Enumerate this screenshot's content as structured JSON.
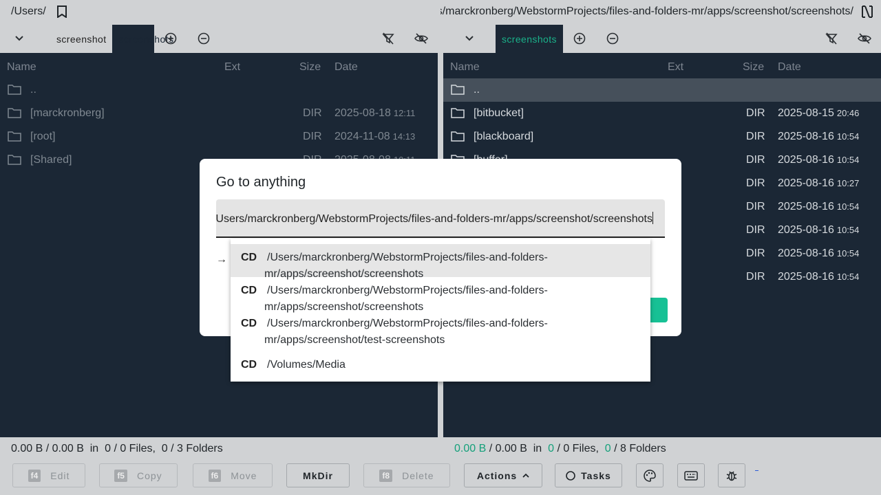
{
  "left": {
    "path": "/Users/",
    "tabs": [
      "screenshot",
      "screenshots"
    ],
    "columns": {
      "name": "Name",
      "ext": "Ext",
      "size": "Size",
      "date": "Date"
    },
    "rows": [
      {
        "name": "..",
        "size": "",
        "date": "",
        "time": ""
      },
      {
        "name": "[marckronberg]",
        "size": "DIR",
        "date": "2025-08-18",
        "time": "12:11"
      },
      {
        "name": "[root]",
        "size": "DIR",
        "date": "2024-11-08",
        "time": "14:13"
      },
      {
        "name": "[Shared]",
        "size": "DIR",
        "date": "2025-08-08",
        "time": "10:11"
      }
    ],
    "status": {
      "a": "0.00 B",
      "b": " / 0.00 B  in  ",
      "c": "0",
      "d": " / 0 Files,  ",
      "e": "0",
      "f": " / 3 Folders"
    }
  },
  "right": {
    "path": "/Users/marckronberg/WebstormProjects/files-and-folders-mr/apps/screenshot/screenshots/",
    "tabs": [
      "screenshots"
    ],
    "columns": {
      "name": "Name",
      "ext": "Ext",
      "size": "Size",
      "date": "Date"
    },
    "rows": [
      {
        "name": "..",
        "size": "",
        "date": "",
        "time": ""
      },
      {
        "name": "[bitbucket]",
        "size": "DIR",
        "date": "2025-08-15",
        "time": "20:46"
      },
      {
        "name": "[blackboard]",
        "size": "DIR",
        "date": "2025-08-16",
        "time": "10:54"
      },
      {
        "name": "[buffer]",
        "size": "DIR",
        "date": "2025-08-16",
        "time": "10:54"
      },
      {
        "name": "",
        "size": "DIR",
        "date": "2025-08-16",
        "time": "10:27"
      },
      {
        "name": "",
        "size": "DIR",
        "date": "2025-08-16",
        "time": "10:54"
      },
      {
        "name": "",
        "size": "DIR",
        "date": "2025-08-16",
        "time": "10:54"
      },
      {
        "name": "",
        "size": "DIR",
        "date": "2025-08-16",
        "time": "10:54"
      },
      {
        "name": "",
        "size": "DIR",
        "date": "2025-08-16",
        "time": "10:54"
      }
    ],
    "status": {
      "a": "0.00 B",
      "b": " / 0.00 B  in  ",
      "c": "0",
      "d": " / 0 Files,  ",
      "e": "0",
      "f": " / 8 Folders"
    }
  },
  "buttons": {
    "edit": {
      "key": "f4",
      "label": "Edit"
    },
    "copy": {
      "key": "f5",
      "label": "Copy"
    },
    "move": {
      "key": "f6",
      "label": "Move"
    },
    "mkdir": {
      "label": "MkDir"
    },
    "delete": {
      "key": "f8",
      "label": "Delete"
    },
    "actions": {
      "label": "Actions"
    },
    "tasks": {
      "label": "Tasks"
    }
  },
  "dialog": {
    "title": "Go to anything",
    "input_value": "/Users/marckronberg/WebstormProjects/files-and-folders-mr/apps/screenshot/screenshots",
    "arrow": "→",
    "suggestions": [
      {
        "prefix": "CD",
        "line1": "/Users/marckronberg/WebstormProjects/files-and-folders-",
        "line2": "mr/apps/screenshot/screenshots"
      },
      {
        "prefix": "CD",
        "line1": "/Users/marckronberg/WebstormProjects/files-and-folders-",
        "line2": "mr/apps/screenshot/screenshots"
      },
      {
        "prefix": "CD",
        "line1": "/Users/marckronberg/WebstormProjects/files-and-folders-",
        "line2": "mr/apps/screenshot/test-screenshots"
      },
      {
        "prefix": "CD",
        "line1": "/Volumes/Media",
        "line2": ""
      }
    ]
  },
  "colors": {
    "panel": "#1b2735",
    "accent": "#17c195",
    "chrome": "#d0d2d4"
  }
}
